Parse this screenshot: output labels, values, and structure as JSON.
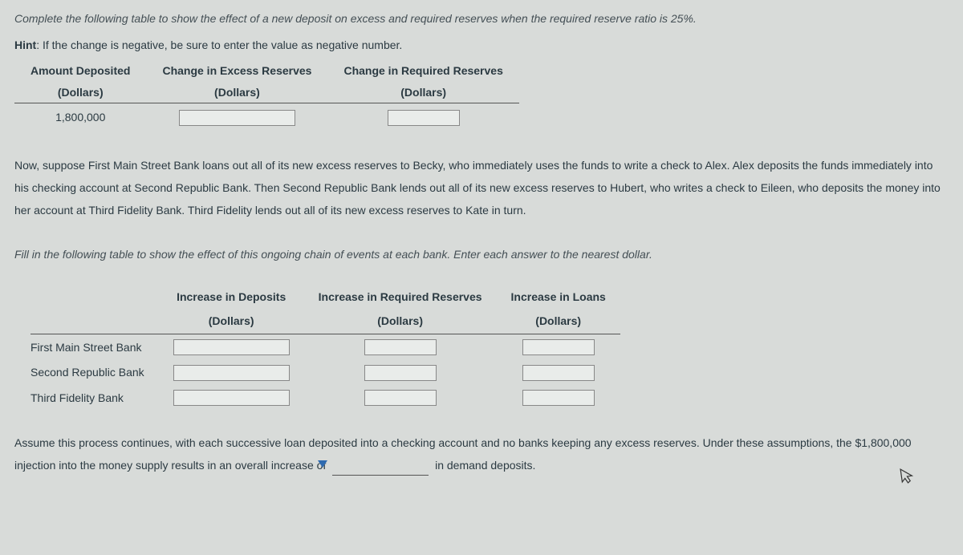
{
  "intro_italic": "Complete the following table to show the effect of a new deposit on excess and required reserves when the required reserve ratio is 25%.",
  "hint": {
    "label": "Hint",
    "text": ": If the change is negative, be sure to enter the value as negative number."
  },
  "table1": {
    "headers": {
      "col1a": "Amount Deposited",
      "col1b": "(Dollars)",
      "col2a": "Change in Excess Reserves",
      "col2b": "(Dollars)",
      "col3a": "Change in Required Reserves",
      "col3b": "(Dollars)"
    },
    "row": {
      "amount": "1,800,000",
      "excess": "",
      "required": ""
    }
  },
  "para1": "Now, suppose First Main Street Bank loans out all of its new excess reserves to Becky, who immediately uses the funds to write a check to Alex. Alex deposits the funds immediately into his checking account at Second Republic Bank. Then Second Republic Bank lends out all of its new excess reserves to Hubert, who writes a check to Eileen, who deposits the money into her account at Third Fidelity Bank. Third Fidelity lends out all of its new excess reserves to Kate in turn.",
  "para2_italic": "Fill in the following table to show the effect of this ongoing chain of events at each bank. Enter each answer to the nearest dollar.",
  "table2": {
    "headers": {
      "col1a": "Increase in Deposits",
      "col1b": "(Dollars)",
      "col2a": "Increase in Required Reserves",
      "col2b": "(Dollars)",
      "col3a": "Increase in Loans",
      "col3b": "(Dollars)"
    },
    "rows": [
      {
        "bank": "First Main Street Bank",
        "deposits": "",
        "required": "",
        "loans": ""
      },
      {
        "bank": "Second Republic Bank",
        "deposits": "",
        "required": "",
        "loans": ""
      },
      {
        "bank": "Third Fidelity Bank",
        "deposits": "",
        "required": "",
        "loans": ""
      }
    ]
  },
  "final": {
    "part1": "Assume this process continues, with each successive loan deposited into a checking account and no banks keeping any excess reserves. Under these assumptions, the $1,800,000 injection into the money supply results in an overall increase of ",
    "part2": " in demand deposits."
  }
}
